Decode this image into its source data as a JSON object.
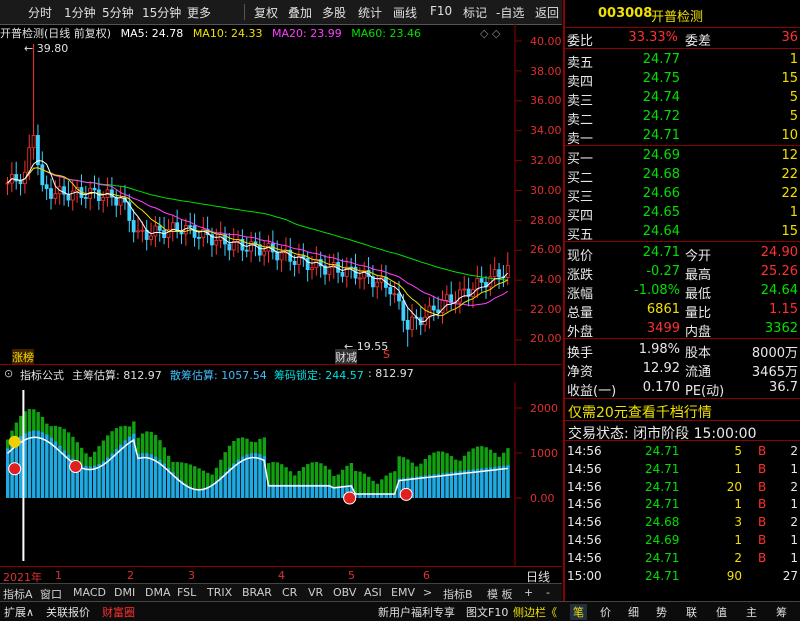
{
  "toolbar": {
    "items": [
      "分时",
      "1分钟",
      "5分钟",
      "15分钟",
      "更多",
      "复权",
      "叠加",
      "多股",
      "统计",
      "画线",
      "F10",
      "标记",
      "-自选",
      "返回"
    ]
  },
  "main_header": {
    "title": "开普检测(日线 前复权)",
    "ma5": "MA5: 24.78",
    "ma10": "MA10: 24.33",
    "ma20": "MA20: 23.99",
    "ma60": "MA60: 23.46",
    "high_marker": "39.80",
    "low_marker": "19.55",
    "tag_left": "涨榜",
    "tag_mid": "财减",
    "tag_s": "S",
    "colors": {
      "ma5": "#ffffff",
      "ma10": "#f0e000",
      "ma20": "#ff40ff",
      "ma60": "#00e000",
      "up": "#ff3030",
      "down": "#40d0ff"
    }
  },
  "price_axis": [
    "40.00",
    "38.00",
    "36.00",
    "34.00",
    "32.00",
    "30.00",
    "28.00",
    "26.00",
    "24.00",
    "22.00",
    "20.00"
  ],
  "indicator": {
    "name": "指标公式",
    "main": "主筹估算: 812.97",
    "retail": "散筹估算: 1057.54",
    "lock": "筹码锁定: 244.57",
    "extra": ": 812.97",
    "axis": [
      "2000",
      "1000",
      "0.00"
    ]
  },
  "date_axis": {
    "year": "2021年",
    "months": [
      "1",
      "2",
      "3",
      "4",
      "5",
      "6"
    ],
    "label": "日线"
  },
  "tabs": [
    "指标A",
    "窗口",
    "MACD",
    "DMI",
    "DMA",
    "FSL",
    "TRIX",
    "BRAR",
    "CR",
    "VR",
    "OBV",
    "ASI",
    "EMV",
    ">",
    "指标B",
    "模 板",
    "+",
    "-"
  ],
  "statusbar": {
    "left": [
      "扩展∧",
      "关联报价",
      "财富圈"
    ],
    "middle": [
      "新用户福利专享",
      "图文F10",
      "侧边栏《"
    ],
    "right": [
      "笔",
      "价",
      "细",
      "势",
      "联",
      "值",
      "主",
      "筹"
    ]
  },
  "quote": {
    "code": "003008",
    "name": "开普检测",
    "weibi_label": "委比",
    "weibi": "33.33%",
    "weicha_label": "委差",
    "weicha": "36",
    "asks": [
      {
        "label": "卖五",
        "price": "24.77",
        "vol": "1"
      },
      {
        "label": "卖四",
        "price": "24.75",
        "vol": "15"
      },
      {
        "label": "卖三",
        "price": "24.74",
        "vol": "5"
      },
      {
        "label": "卖二",
        "price": "24.72",
        "vol": "5"
      },
      {
        "label": "卖一",
        "price": "24.71",
        "vol": "10"
      }
    ],
    "bids": [
      {
        "label": "买一",
        "price": "24.69",
        "vol": "12"
      },
      {
        "label": "买二",
        "price": "24.68",
        "vol": "22"
      },
      {
        "label": "买三",
        "price": "24.66",
        "vol": "22"
      },
      {
        "label": "买四",
        "price": "24.65",
        "vol": "1"
      },
      {
        "label": "买五",
        "price": "24.64",
        "vol": "15"
      }
    ],
    "stats": [
      {
        "l1": "现价",
        "v1": "24.71",
        "l2": "今开",
        "v2": "24.90"
      },
      {
        "l1": "涨跌",
        "v1": "-0.27",
        "l2": "最高",
        "v2": "25.26"
      },
      {
        "l1": "涨幅",
        "v1": "-1.08%",
        "l2": "最低",
        "v2": "24.64"
      },
      {
        "l1": "总量",
        "v1": "6861",
        "l2": "量比",
        "v2": "1.15"
      },
      {
        "l1": "外盘",
        "v1": "3499",
        "l2": "内盘",
        "v2": "3362"
      }
    ],
    "stats2": [
      {
        "l1": "换手",
        "v1": "1.98%",
        "l2": "股本",
        "v2": "8000万"
      },
      {
        "l1": "净资",
        "v1": "12.92",
        "l2": "流通",
        "v2": "3465万"
      },
      {
        "l1": "收益(一)",
        "v1": "0.170",
        "l2": "PE(动)",
        "v2": "36.7"
      }
    ],
    "promo": "仅需20元查看千档行情",
    "trade_status": "交易状态: 闭市阶段 15:00:00",
    "ticks": [
      {
        "t": "14:56",
        "p": "24.71",
        "v": "5",
        "d": "B",
        "n": "2"
      },
      {
        "t": "14:56",
        "p": "24.71",
        "v": "1",
        "d": "B",
        "n": "1"
      },
      {
        "t": "14:56",
        "p": "24.71",
        "v": "20",
        "d": "B",
        "n": "2"
      },
      {
        "t": "14:56",
        "p": "24.71",
        "v": "1",
        "d": "B",
        "n": "1"
      },
      {
        "t": "14:56",
        "p": "24.68",
        "v": "3",
        "d": "B",
        "n": "2"
      },
      {
        "t": "14:56",
        "p": "24.69",
        "v": "1",
        "d": "B",
        "n": "1"
      },
      {
        "t": "14:56",
        "p": "24.71",
        "v": "2",
        "d": "B",
        "n": "1"
      },
      {
        "t": "15:00",
        "p": "24.71",
        "v": "90",
        "d": "",
        "n": "27"
      }
    ]
  }
}
